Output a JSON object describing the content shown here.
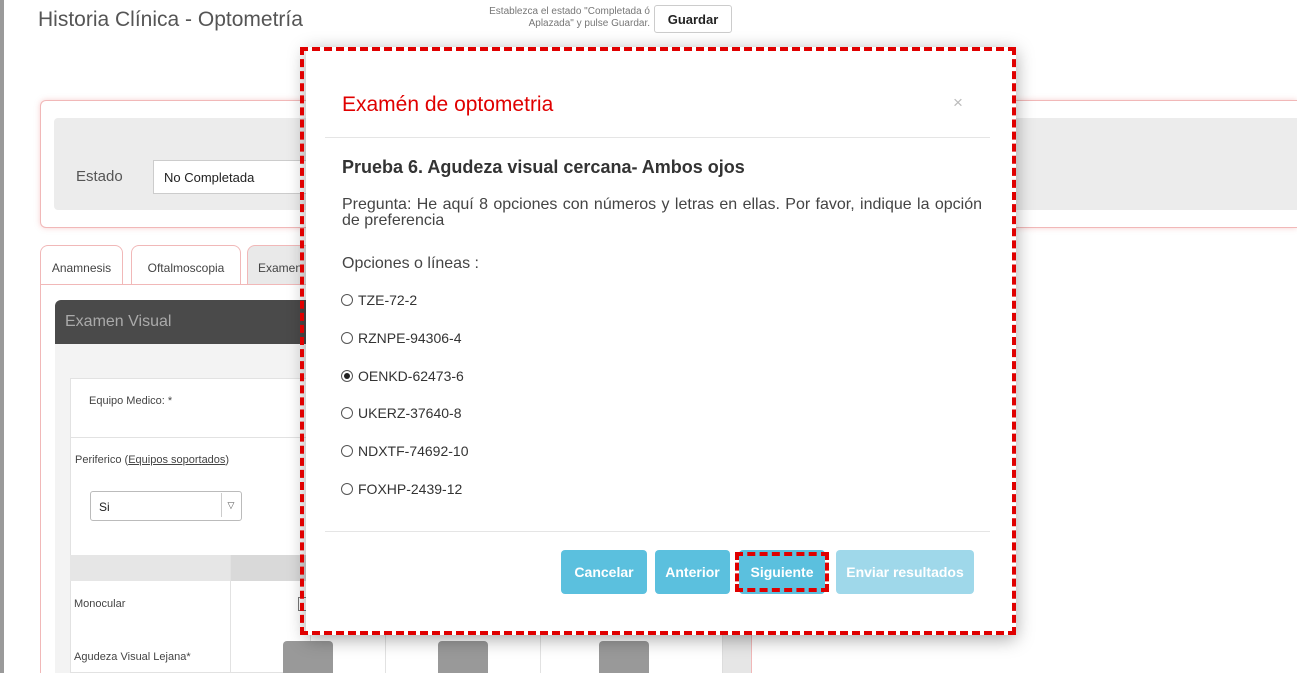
{
  "page": {
    "title": "Historia Clínica - Optometría",
    "hint_line1": "Establezca el estado \"Completada ó",
    "hint_line2": "Aplazada\" y pulse Guardar.",
    "save_label": "Guardar"
  },
  "estado": {
    "label": "Estado",
    "value": "No Completada"
  },
  "tabs": [
    {
      "label": "Anamnesis"
    },
    {
      "label": "Oftalmoscopia"
    },
    {
      "label": "Examen"
    }
  ],
  "examen_visual": {
    "header": "Examen Visual",
    "equipo_label": "Equipo Medico: *",
    "periferico_label": "Periferico (",
    "periferico_link": "Equipos soportados",
    "periferico_end": ")",
    "periferico_value": "Si",
    "select_arrow": "▽",
    "monocular_label": "Monocular",
    "agudeza_label": "Agudeza Visual Lejana*"
  },
  "modal": {
    "title": "Examén de optometria",
    "close": "×",
    "question_title": "Prueba 6. Agudeza visual cercana- Ambos ojos",
    "question_text": "Pregunta: He aquí 8 opciones con números y letras en ellas. Por favor, indique la opción de preferencia",
    "options_label": "Opciones o líneas :",
    "options": [
      {
        "label": "TZE-72-2",
        "checked": false
      },
      {
        "label": "RZNPE-94306-4",
        "checked": false
      },
      {
        "label": "OENKD-62473-6",
        "checked": true
      },
      {
        "label": "UKERZ-37640-8",
        "checked": false
      },
      {
        "label": "NDXTF-74692-10",
        "checked": false
      },
      {
        "label": "FOXHP-2439-12",
        "checked": false
      }
    ],
    "buttons": {
      "cancel": "Cancelar",
      "previous": "Anterior",
      "next": "Siguiente",
      "submit": "Enviar resultados"
    }
  },
  "colors": {
    "accent_red": "#e00000",
    "button_info": "#5bc0de",
    "button_disabled": "#9fd8ea"
  }
}
